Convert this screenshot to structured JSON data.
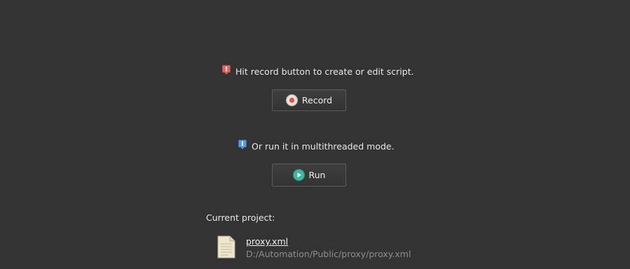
{
  "record_section": {
    "hint_icon": "red-info-icon",
    "hint_text": "Hit record button to create or edit script.",
    "button_icon": "record-icon",
    "button_label": "Record"
  },
  "run_section": {
    "hint_icon": "blue-info-icon",
    "hint_text": "Or run it in multithreaded mode.",
    "button_icon": "play-icon",
    "button_label": "Run"
  },
  "project": {
    "label": "Current project:",
    "file_icon": "document-icon",
    "file_name": "proxy.xml",
    "file_path": "D:/Automation/Public/proxy/proxy.xml"
  },
  "colors": {
    "background": "#333333",
    "record_red": "#d9534f",
    "run_teal": "#3fb8a0",
    "hint_red": "#e05a5a",
    "hint_blue": "#4a90d9"
  }
}
